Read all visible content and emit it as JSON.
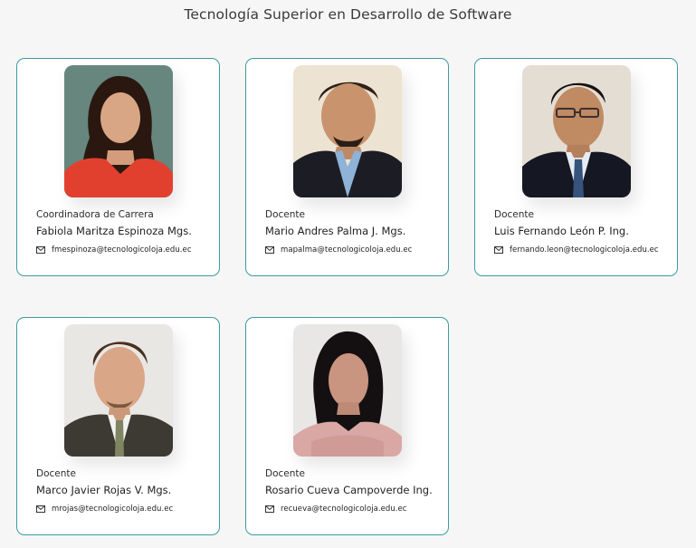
{
  "page": {
    "title": "Tecnología Superior en Desarrollo de Software"
  },
  "staff": [
    {
      "role": "Coordinadora de Carrera",
      "name": "Fabiola Maritza Espinoza Mgs.",
      "email": "fmespinoza@tecnologicoloja.edu.ec"
    },
    {
      "role": "Docente",
      "name": "Mario Andres Palma J. Mgs.",
      "email": "mapalma@tecnologicoloja.edu.ec"
    },
    {
      "role": "Docente",
      "name": "Luis Fernando León P. Ing.",
      "email": "fernando.leon@tecnologicoloja.edu.ec"
    },
    {
      "role": "Docente",
      "name": "Marco Javier Rojas V. Mgs.",
      "email": "mrojas@tecnologicoloja.edu.ec"
    },
    {
      "role": "Docente",
      "name": "Rosario Cueva Campoverde Ing.",
      "email": "recueva@tecnologicoloja.edu.ec"
    }
  ],
  "icons": {
    "email": "envelope-icon"
  },
  "colors": {
    "card_border": "#3c9ba1",
    "background": "#f6f6f6"
  }
}
